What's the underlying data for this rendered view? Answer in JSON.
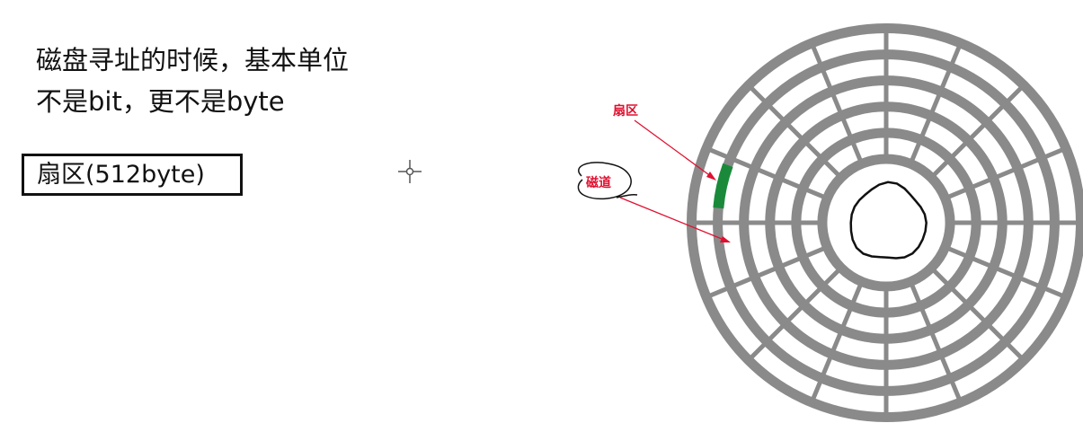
{
  "intro": {
    "line1": "磁盘寻址的时候，基本单位",
    "line2": "不是bit，更不是byte"
  },
  "boxed_label": "扇区(512byte)",
  "diagram": {
    "sector_label": "扇区",
    "track_label": "磁道",
    "rings": 6,
    "spokes": 16,
    "colors": {
      "track": "#8a8a8a",
      "highlight": "#1a8a3a",
      "annotation": "#e01030"
    }
  }
}
